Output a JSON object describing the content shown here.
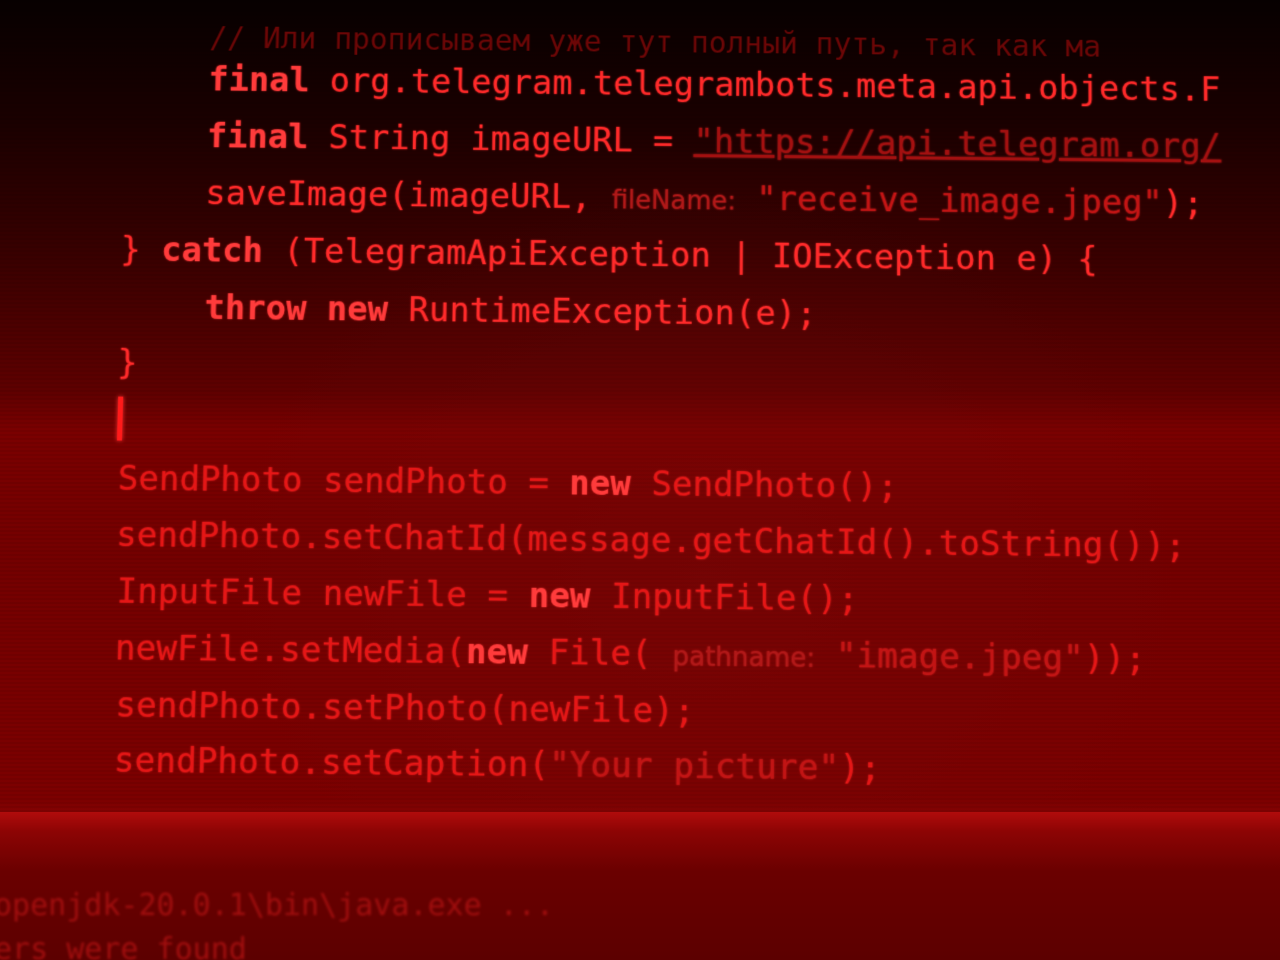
{
  "code_lines": [
    {
      "segments": [
        {
          "text": "// Или прописываем уже тут полный путь, так как ма"
        }
      ]
    },
    {
      "segments": [
        {
          "text": "final",
          "cls": "kw"
        },
        {
          "text": " org.telegram.telegrambots.meta.api.objects.F"
        }
      ]
    },
    {
      "segments": [
        {
          "text": "final",
          "cls": "kw"
        },
        {
          "text": " String imageURL = "
        },
        {
          "text": "\"https://api.telegram.org/",
          "cls": "url"
        }
      ]
    },
    {
      "segments": [
        {
          "text": "saveImage(imageURL, "
        },
        {
          "text": "fileName:",
          "cls": "hint"
        },
        {
          "text": " \"receive_image.jpeg\"",
          "cls": "str"
        },
        {
          "text": ");"
        }
      ]
    },
    {
      "segments": [
        {
          "text": "} "
        },
        {
          "text": "catch",
          "cls": "kw"
        },
        {
          "text": " (TelegramApiException | IOException e) {"
        }
      ]
    },
    {
      "segments": [
        {
          "text": "throw new",
          "cls": "kw"
        },
        {
          "text": " RuntimeException(e);"
        }
      ]
    },
    {
      "segments": [
        {
          "text": "}"
        }
      ]
    },
    {
      "segments": [
        {
          "text": "SendPhoto sendPhoto = "
        },
        {
          "text": "new",
          "cls": "kw"
        },
        {
          "text": " SendPhoto();"
        }
      ]
    },
    {
      "segments": [
        {
          "text": "sendPhoto.setChatId(message.getChatId().toString());"
        }
      ]
    },
    {
      "segments": [
        {
          "text": "InputFile newFile = "
        },
        {
          "text": "new",
          "cls": "kw"
        },
        {
          "text": " InputFile();"
        }
      ]
    },
    {
      "segments": [
        {
          "text": "newFile.setMedia("
        },
        {
          "text": "new",
          "cls": "kw"
        },
        {
          "text": " File( "
        },
        {
          "text": "pathname:",
          "cls": "hint"
        },
        {
          "text": " \"image.jpeg\"",
          "cls": "str"
        },
        {
          "text": "));"
        }
      ]
    },
    {
      "segments": [
        {
          "text": "sendPhoto.setPhoto(newFile);"
        }
      ]
    },
    {
      "segments": [
        {
          "text": "sendPhoto.setCaption("
        },
        {
          "text": "\"Your picture\"",
          "cls": "str"
        },
        {
          "text": ");"
        }
      ]
    }
  ],
  "console_lines": [
    "openjdk-20.0.1\\bin\\java.exe ...",
    "ers were found"
  ],
  "colors": {
    "code": "#ff2a2a",
    "background": "#5a0000"
  }
}
